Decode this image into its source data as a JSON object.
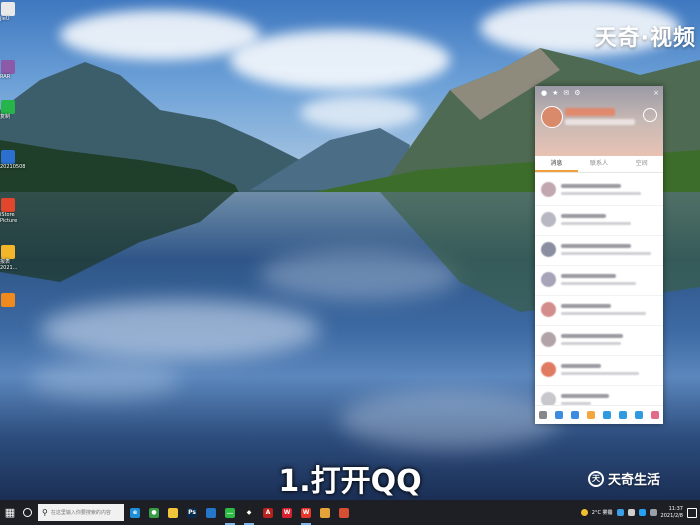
{
  "desktop": {
    "icons": [
      {
        "label": "jieU",
        "color": "#e9e9e9",
        "accent": "#4aa34a"
      },
      {
        "label": "RAR",
        "color": "#8c5aa8",
        "accent": "#f2c200"
      },
      {
        "label": "复制",
        "color": "#27b54b",
        "accent": "#ffffff"
      },
      {
        "label": "20210508",
        "color": "#2b6fd1",
        "accent": "#ffffff"
      },
      {
        "label": "iStore\nPicture",
        "color": "#e2462c",
        "accent": "#ffffff"
      },
      {
        "label": "报表\n2021...",
        "color": "#f3b62b",
        "accent": "#ffffff"
      },
      {
        "label": "",
        "color": "#f08a1c",
        "accent": "#ffffff"
      }
    ]
  },
  "watermark": {
    "top_text": "天奇·视频",
    "bottom_logo": "天",
    "bottom_text": "天奇生活"
  },
  "caption": "1.打开QQ",
  "qq": {
    "tabs": [
      {
        "label": "消息",
        "active": true
      },
      {
        "label": "联系人",
        "active": false
      },
      {
        "label": "空间",
        "active": false
      }
    ],
    "conversation_count": 8,
    "bottom_icons": [
      "menu-icon",
      "contacts-icon",
      "game-icon",
      "folder-icon",
      "star-icon",
      "gamepad-icon",
      "qzone-icon",
      "apps-icon"
    ]
  },
  "taskbar": {
    "search_placeholder": "在这里输入你要搜索的内容",
    "apps": [
      {
        "name": "edge-icon",
        "color": "#1f8fd6",
        "glyph": "e",
        "open": false
      },
      {
        "name": "chrome-icon",
        "color": "#3a9c47",
        "glyph": "●",
        "open": false
      },
      {
        "name": "explorer-icon",
        "color": "#f2c63c",
        "glyph": "",
        "open": false
      },
      {
        "name": "photoshop-icon",
        "color": "#0b2a4a",
        "glyph": "Ps",
        "open": false
      },
      {
        "name": "store-icon",
        "color": "#2577c9",
        "glyph": "",
        "open": false
      },
      {
        "name": "wechat-icon",
        "color": "#2dbb45",
        "glyph": "…",
        "open": true
      },
      {
        "name": "qq-icon",
        "color": "#1f1f1f",
        "glyph": "◆",
        "open": true
      },
      {
        "name": "acrobat-icon",
        "color": "#b7221c",
        "glyph": "A",
        "open": false
      },
      {
        "name": "wps-icon",
        "color": "#d6202e",
        "glyph": "W",
        "open": false
      },
      {
        "name": "wps-writer-icon",
        "color": "#e7352b",
        "glyph": "W",
        "open": true
      },
      {
        "name": "notes-icon",
        "color": "#e6a33a",
        "glyph": "",
        "open": false
      },
      {
        "name": "media-icon",
        "color": "#d64f33",
        "glyph": "",
        "open": false
      }
    ],
    "weather": "2°C 雾霾",
    "clock_time": "11:37",
    "clock_date": "2021/2/8"
  }
}
